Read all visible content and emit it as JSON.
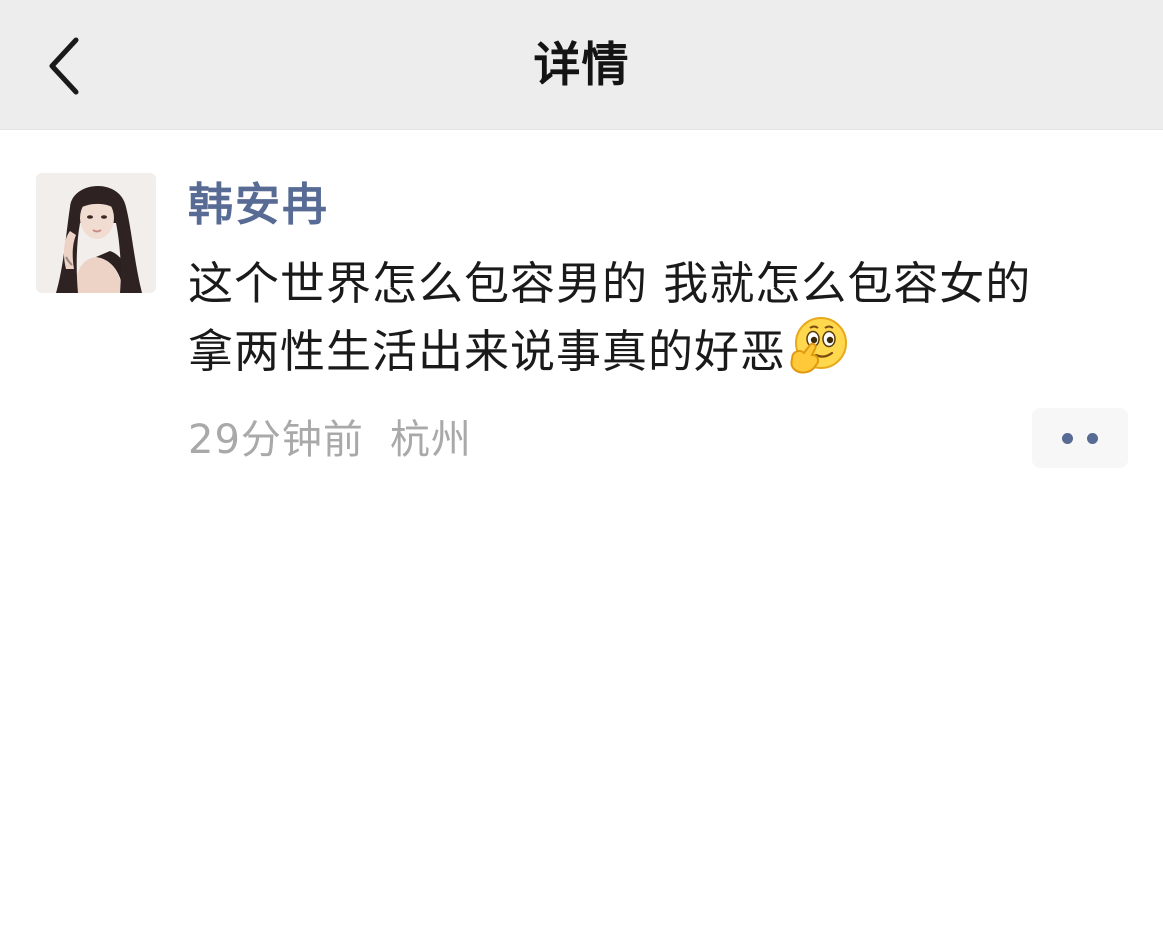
{
  "header": {
    "title": "详情",
    "back_icon": "chevron-left-icon"
  },
  "post": {
    "author": "韩安冉",
    "text_line_1": "这个世界怎么包容男的 我就怎么包容女的",
    "text_line_2": "拿两性生活出来说事真的好恶",
    "emoji": "thinking-face-emoji",
    "time": "29分钟前",
    "location": "杭州",
    "more_icon": "more-dots-icon"
  },
  "colors": {
    "nav_background": "#ededed",
    "author_name": "#576b95",
    "body_text": "#1a1a1a",
    "meta_text": "#a9a9a9"
  }
}
